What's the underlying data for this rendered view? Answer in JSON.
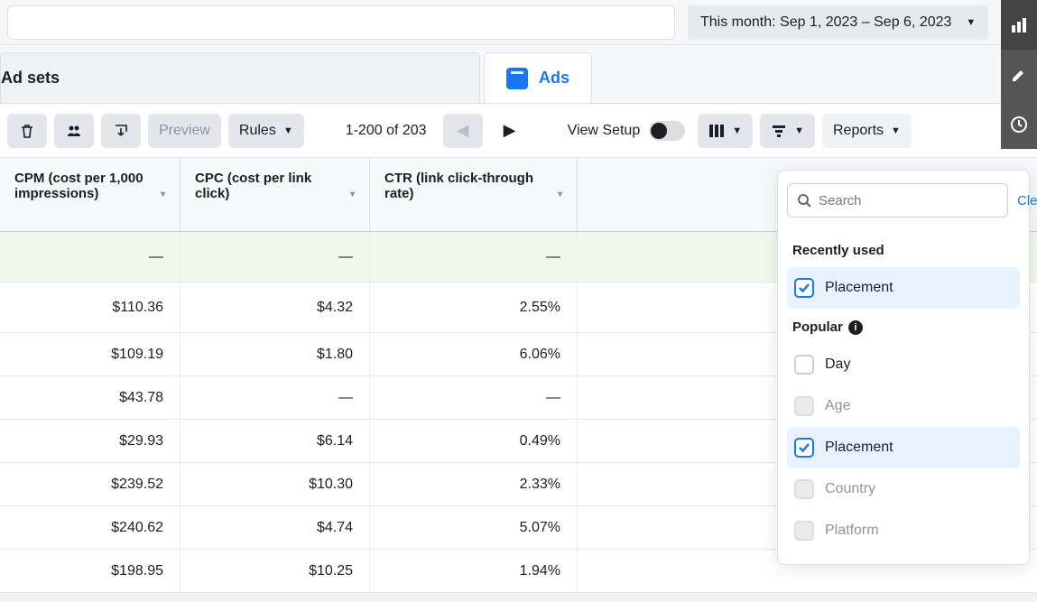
{
  "top": {
    "date_range_label": "This month: Sep 1, 2023 – Sep 6, 2023"
  },
  "tabs": {
    "adsets": "Ad sets",
    "ads": "Ads"
  },
  "toolbar": {
    "preview": "Preview",
    "rules": "Rules",
    "page_info": "1-200 of 203",
    "view_setup": "View Setup",
    "reports": "Reports"
  },
  "table": {
    "headers": {
      "cpm": "CPM (cost per 1,000 impressions)",
      "cpc": "CPC (cost per link click)",
      "ctr": "CTR (link click-through rate)"
    },
    "rows": [
      {
        "cpm": "—",
        "cpc": "—",
        "ctr": "—"
      },
      {
        "cpm": "$110.36",
        "cpc": "$4.32",
        "ctr": "2.55%"
      },
      {
        "cpm": "$109.19",
        "cpc": "$1.80",
        "ctr": "6.06%"
      },
      {
        "cpm": "$43.78",
        "cpc": "—",
        "ctr": "—"
      },
      {
        "cpm": "$29.93",
        "cpc": "$6.14",
        "ctr": "0.49%"
      },
      {
        "cpm": "$239.52",
        "cpc": "$10.30",
        "ctr": "2.33%"
      },
      {
        "cpm": "$240.62",
        "cpc": "$4.74",
        "ctr": "5.07%"
      },
      {
        "cpm": "$198.95",
        "cpc": "$10.25",
        "ctr": "1.94%"
      }
    ]
  },
  "breakdown": {
    "search_placeholder": "Search",
    "clear_all": "Clear all",
    "recently_used_label": "Recently used",
    "popular_label": "Popular",
    "recently_used": [
      {
        "label": "Placement",
        "checked": true,
        "selected": true
      }
    ],
    "popular": [
      {
        "label": "Day",
        "checked": false,
        "disabled": false
      },
      {
        "label": "Age",
        "checked": false,
        "disabled": true
      },
      {
        "label": "Placement",
        "checked": true,
        "selected": true
      },
      {
        "label": "Country",
        "checked": false,
        "disabled": true
      },
      {
        "label": "Platform",
        "checked": false,
        "disabled": true
      }
    ]
  }
}
